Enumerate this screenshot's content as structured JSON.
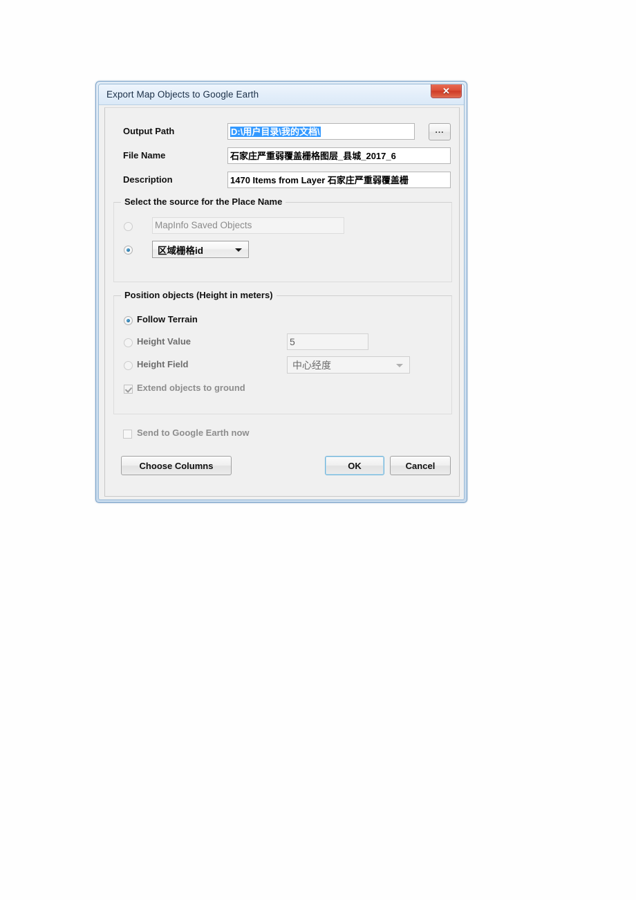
{
  "window": {
    "title": "Export Map Objects to Google Earth",
    "close_icon": "close-icon",
    "close_glyph": "✕"
  },
  "fields": {
    "output_path": {
      "label": "Output Path",
      "value": "D:\\用户目录\\我的文档\\",
      "browse_label": "..."
    },
    "file_name": {
      "label": "File Name",
      "value": "石家庄严重弱覆盖栅格图层_县城_2017_6"
    },
    "description": {
      "label": "Description",
      "value": "1470 Items from Layer 石家庄严重弱覆盖栅"
    }
  },
  "place_name_group": {
    "title": "Select the source for the Place Name",
    "option_saved_objects": {
      "label": "MapInfo Saved Objects",
      "selected": false
    },
    "option_column": {
      "value": "区域栅格id",
      "selected": true
    }
  },
  "position_group": {
    "title": "Position objects (Height in meters)",
    "options": [
      {
        "label": "Follow Terrain",
        "selected": true
      },
      {
        "label": "Height Value",
        "selected": false
      },
      {
        "label": "Height Field",
        "selected": false
      }
    ],
    "height_value": "5",
    "height_field": "中心经度",
    "extend_checkbox": {
      "label": "Extend objects to ground",
      "checked": true,
      "enabled": false
    }
  },
  "footer": {
    "send_checkbox": {
      "label": "Send to Google Earth now",
      "checked": false,
      "enabled": false
    },
    "choose_columns_label": "Choose Columns",
    "ok_label": "OK",
    "cancel_label": "Cancel"
  },
  "colors": {
    "selection_highlight": "#3399ff",
    "close_button": "#d64a33",
    "default_button_focus": "#6fb4d9",
    "dialog_background": "#f0f0f0"
  }
}
